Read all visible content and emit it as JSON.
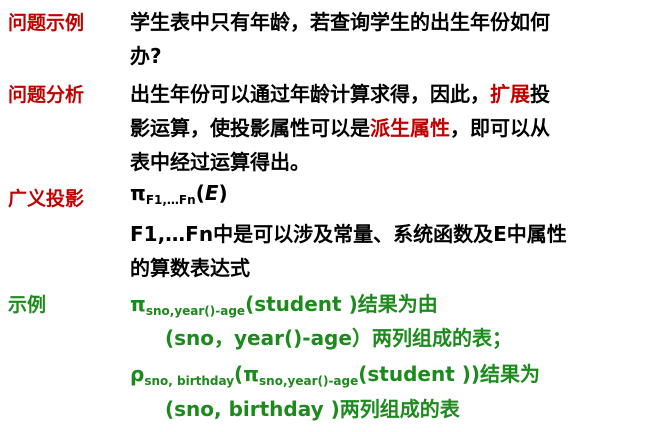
{
  "colors": {
    "label_red": "#c00000",
    "label_green": "#1c8a1c",
    "text_black": "#000000",
    "emphasis_red": "#c00000"
  },
  "example_problem": {
    "label": "问题示例",
    "line1": "学生表中只有年龄，若查询学生的出生年份如何",
    "line2": "办?"
  },
  "analysis": {
    "label": "问题分析",
    "line1_pre": "出生年份可以通过年龄计算求得，因此，",
    "line1_em": "扩展",
    "line1_post": "投",
    "line2_pre": "影运算，使投影属性可以是",
    "line2_em": "派生属性",
    "line2_post": "，即可以从",
    "line3": "表中经过运算得出。"
  },
  "generalized_projection": {
    "label": "广义投影",
    "pi": "π",
    "subscript": "F1,…Fn",
    "expr_open": "(",
    "expr_var": "E",
    "expr_close": ")",
    "desc_line1": "F1,…Fn中是可以涉及常量、系统函数及E中属性",
    "desc_line2": "的算数表达式"
  },
  "example": {
    "label": "示例",
    "ex1_pi": "π",
    "ex1_sub": "sno,year()-age",
    "ex1_rest": "(student )结果为由",
    "ex1_line2": "(sno，year()-age）两列组成的表；",
    "ex2_rho": "ρ",
    "ex2_rho_sub": "sno, birthday",
    "ex2_open": "(",
    "ex2_pi": "π",
    "ex2_pi_sub": "sno,year()-age",
    "ex2_rest": "(student ))结果为",
    "ex2_line2": "(sno, birthday )两列组成的表"
  }
}
